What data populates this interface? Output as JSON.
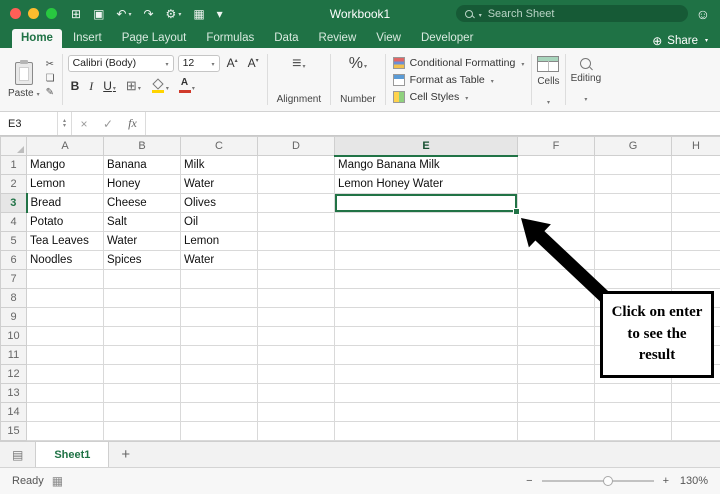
{
  "colors": {
    "excel_green": "#1f7245",
    "selection_green": "#217346",
    "fill_yellow": "#ffd400",
    "font_color_red": "#d03a2b"
  },
  "icons": {
    "app_grid": "⊞",
    "save": "▣",
    "undo": "↶",
    "redo": "↷",
    "gear": "⚙",
    "table": "▦",
    "share": "⊕",
    "smiley": "☺",
    "cut": "✂",
    "copy": "❏",
    "format_painter": "✎",
    "borders": "⊞",
    "align": "≡",
    "close_x": "×",
    "check": "✓",
    "sheet_list": "▤",
    "status_flag": "▦"
  },
  "titlebar": {
    "title": "Workbook1",
    "search_text": "Search Sheet",
    "qat": [
      {
        "name": "app-grid-icon",
        "glyph": "⊞"
      },
      {
        "name": "save-icon",
        "glyph": "▣"
      },
      {
        "name": "undo-icon",
        "glyph": "↶",
        "caret": true
      },
      {
        "name": "redo-icon",
        "glyph": "↷"
      },
      {
        "name": "settings-gear-icon",
        "glyph": "⚙",
        "caret": true
      },
      {
        "name": "table-icon",
        "glyph": "▦"
      },
      {
        "name": "toolbar-options-icon",
        "glyph": "▾"
      }
    ]
  },
  "tabs": {
    "items": [
      "Home",
      "Insert",
      "Page Layout",
      "Formulas",
      "Data",
      "Review",
      "View",
      "Developer"
    ],
    "active": "Home",
    "share_label": "Share"
  },
  "ribbon": {
    "paste_label": "Paste",
    "font_name": "Calibri (Body)",
    "font_size": "12",
    "bold": "B",
    "italic": "I",
    "underline": "U",
    "grow_font": "A",
    "shrink_font": "A",
    "alignment_label": "Alignment",
    "number_symbol": "%",
    "number_label": "Number",
    "styles": [
      "Conditional Formatting",
      "Format as Table",
      "Cell Styles"
    ],
    "cells_label": "Cells",
    "editing_label": "Editing"
  },
  "formula_bar": {
    "fx": "fx"
  },
  "grid": {
    "columns": [
      "A",
      "B",
      "C",
      "D",
      "E",
      "F",
      "G",
      "H"
    ],
    "visible_rows": 15,
    "selected_cell": "E3",
    "rows": [
      [
        "Mango",
        "Banana",
        "Milk",
        "",
        "Mango Banana Milk",
        "",
        "",
        ""
      ],
      [
        "Lemon",
        "Honey",
        "Water",
        "",
        "Lemon Honey Water",
        "",
        "",
        ""
      ],
      [
        "Bread",
        "Cheese",
        "Olives",
        "",
        "",
        "",
        "",
        ""
      ],
      [
        "Potato",
        "Salt",
        "Oil",
        "",
        "",
        "",
        "",
        ""
      ],
      [
        "Tea Leaves",
        "Water",
        "Lemon",
        "",
        "",
        "",
        "",
        ""
      ],
      [
        "Noodles",
        "Spices",
        "Water",
        "",
        "",
        "",
        "",
        ""
      ]
    ]
  },
  "callout": {
    "text": "Click on enter to see the result"
  },
  "sheet_bar": {
    "tabs": [
      "Sheet1"
    ],
    "add_label": "+"
  },
  "status_bar": {
    "ready": "Ready",
    "minus": "−",
    "plus": "+",
    "zoom_level": "130%"
  }
}
